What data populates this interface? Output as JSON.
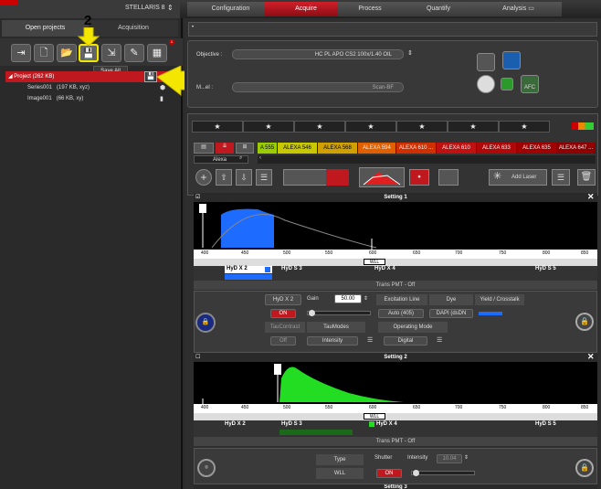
{
  "header": {
    "system": "STELLARIS 8",
    "tabs": [
      "Configuration",
      "Acquire",
      "Process",
      "Quantify",
      "Analysis"
    ]
  },
  "left": {
    "tabs": [
      "Open projects",
      "Acquisition"
    ],
    "tooltip": "Save All",
    "project": "Project  (262 KB)",
    "items": [
      {
        "name": "Series001",
        "size": "(197 KB, xyz)"
      },
      {
        "name": "Image001",
        "size": "(66 KB, xy)"
      }
    ],
    "badge": "1"
  },
  "callouts": {
    "one": "1",
    "two": "2"
  },
  "objective": {
    "label": "Objective :",
    "value": "HC PL APO CS2  100x/1.40 OIL",
    "scan_label": "M...el :",
    "scan_value": "Scan-BF",
    "afc": "AFC"
  },
  "laser": {
    "dyes": [
      "A 555",
      "ALEXA 546",
      "ALEXA 568",
      "ALEXA 594",
      "ALEXA 610 ...",
      "ALEXA 610",
      "ALEXA 633",
      "ALEXA 635",
      "ALEXA 647 ..."
    ],
    "filter": "Alexa",
    "add_laser": "Add Laser"
  },
  "setting1": {
    "title": "Setting 1",
    "ticks": [
      "400",
      "450",
      "500",
      "550",
      "600",
      "650",
      "700",
      "750",
      "800",
      "850"
    ],
    "wll": "WLL",
    "detectors": [
      "HyD X 2",
      "HyD S 3",
      "HyD X 4",
      "HyD S 5"
    ],
    "trans": "Trans PMT - Off",
    "table": {
      "hyd": "HyD X 2",
      "gain_label": "Gain",
      "gain": "50.00",
      "excitation_label": "Excitation Line",
      "excitation": "Auto (405)",
      "dye_label": "Dye",
      "dye": "DAPI (dsDN",
      "yield_label": "Yield / Crosstalk",
      "on": "ON",
      "taucontrast": "TauContrast",
      "taumodes": "TauModes",
      "operating_mode": "Operating Mode",
      "off": "Off",
      "intensity": "Intensity",
      "digital": "Digital"
    }
  },
  "setting2": {
    "title": "Setting 2",
    "detectors": [
      "HyD X 2",
      "HyD S 3",
      "HyD X 4",
      "HyD S 5"
    ],
    "trans": "Trans PMT - Off",
    "type_label": "Type",
    "type_value": "WLL",
    "shutter": "Shutter",
    "intensity_label": "Intensity",
    "intensity_value": "10.04",
    "on": "ON"
  },
  "setting3": {
    "title": "Setting 3"
  },
  "colors": {
    "accent_red": "#c0181f",
    "highlight": "#f3e600",
    "blue_peak": "#1e6cff",
    "green_peak": "#22dd22"
  }
}
